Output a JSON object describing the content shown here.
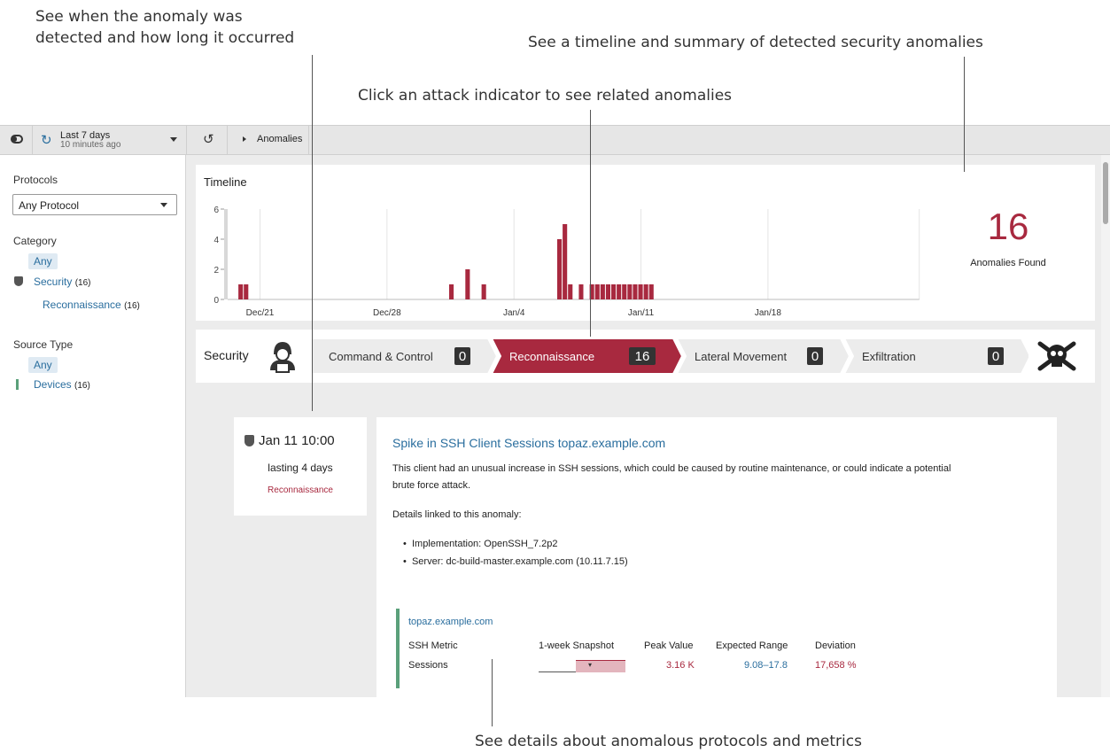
{
  "callouts": {
    "top_left_1": "See when the anomaly was",
    "top_left_2": "detected and how long it occurred",
    "top_right": "See a timeline and summary of detected security anomalies",
    "middle": "Click an attack indicator to see related anomalies",
    "bottom": "See details about anomalous protocols and metrics"
  },
  "topbar": {
    "time_range": "Last 7 days",
    "time_updated": "10 minutes ago",
    "breadcrumb": "Anomalies"
  },
  "sidebar": {
    "protocols_label": "Protocols",
    "protocol_value": "Any Protocol",
    "category_label": "Category",
    "category_any": "Any",
    "security_label": "Security",
    "security_count": "(16)",
    "recon_label": "Reconnaissance",
    "recon_count": "(16)",
    "source_type_label": "Source Type",
    "source_any": "Any",
    "devices_label": "Devices",
    "devices_count": "(16)"
  },
  "timeline": {
    "title": "Timeline",
    "count": "16",
    "count_label": "Anomalies Found"
  },
  "chart_data": {
    "type": "bar",
    "title": "Timeline",
    "xlabel": "",
    "ylabel": "",
    "ylim": [
      0,
      6
    ],
    "yticks": [
      "6",
      "4",
      "2",
      "0"
    ],
    "xticks": [
      "Dec/21",
      "Dec/28",
      "Jan/4",
      "Jan/11",
      "Jan/18"
    ],
    "color": "#a8293f",
    "bars": [
      {
        "slot": 1,
        "value": 1
      },
      {
        "slot": 2,
        "value": 1
      },
      {
        "slot": 40,
        "value": 1
      },
      {
        "slot": 43,
        "value": 2
      },
      {
        "slot": 46,
        "value": 1
      },
      {
        "slot": 60,
        "value": 4
      },
      {
        "slot": 61,
        "value": 5
      },
      {
        "slot": 62,
        "value": 1
      },
      {
        "slot": 64,
        "value": 1
      },
      {
        "slot": 66,
        "value": 1
      },
      {
        "slot": 67,
        "value": 1
      },
      {
        "slot": 68,
        "value": 1
      },
      {
        "slot": 69,
        "value": 1
      },
      {
        "slot": 70,
        "value": 1
      },
      {
        "slot": 71,
        "value": 1
      },
      {
        "slot": 72,
        "value": 1
      },
      {
        "slot": 73,
        "value": 1
      },
      {
        "slot": 74,
        "value": 1
      },
      {
        "slot": 75,
        "value": 1
      },
      {
        "slot": 76,
        "value": 1
      },
      {
        "slot": 77,
        "value": 1
      }
    ]
  },
  "chain": {
    "title": "Security",
    "stages": [
      {
        "label": "Command & Control",
        "count": "0"
      },
      {
        "label": "Reconnaissance",
        "count": "16"
      },
      {
        "label": "Lateral Movement",
        "count": "0"
      },
      {
        "label": "Exfiltration",
        "count": "0"
      }
    ]
  },
  "detection": {
    "time": "Jan 11 10:00",
    "duration": "lasting 4 days",
    "category": "Reconnaissance"
  },
  "anomaly": {
    "title": "Spike in SSH Client Sessions topaz.example.com",
    "description": "This client had an unusual increase in SSH sessions, which could be caused by routine maintenance, or could indicate a potential",
    "description_2": "brute force attack.",
    "details_label": "Details linked to this anomaly:",
    "detail_1": "Implementation: OpenSSH_7.2p2",
    "detail_2": "Server: dc-build-master.example.com (10.11.7.15)",
    "device": "topaz.example.com",
    "headers": [
      "SSH Metric",
      "1-week Snapshot",
      "Peak Value",
      "Expected Range",
      "Deviation"
    ],
    "row": {
      "metric": "Sessions",
      "peak": "3.16 K",
      "range": "9.08–17.8",
      "deviation": "17,658 %"
    }
  },
  "colors": {
    "accent": "#a8293f",
    "link": "#2a6e9e",
    "device_bar": "#5aa07a"
  }
}
